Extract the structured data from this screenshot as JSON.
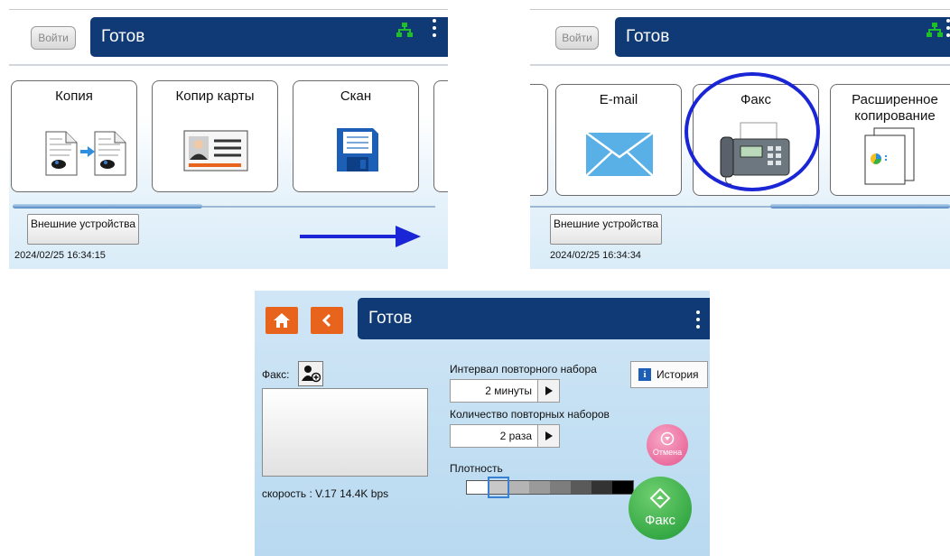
{
  "screen1": {
    "login_label": "Войти",
    "title": "Готов",
    "tiles": [
      {
        "label": "Копия",
        "icon": "copy-icon"
      },
      {
        "label": "Копир карты",
        "icon": "id-card-icon"
      },
      {
        "label": "Скан",
        "icon": "floppy-disk-icon"
      }
    ],
    "external_devices": "Внешние устройства",
    "timestamp": "2024/02/25 16:34:15"
  },
  "screen2": {
    "login_label": "Войти",
    "title": "Готов",
    "tiles": [
      {
        "label": "E-mail",
        "icon": "envelope-icon"
      },
      {
        "label": "Факс",
        "icon": "fax-machine-icon"
      },
      {
        "label": "Расширенное копирование",
        "icon": "advanced-copy-icon"
      }
    ],
    "external_devices": "Внешние устройства",
    "timestamp": "2024/02/25 16:34:34"
  },
  "fax_screen": {
    "title": "Готов",
    "fax_label": "Факс:",
    "speed": "скорость : V.17  14.4K bps",
    "redial_interval_label": "Интервал повторного набора",
    "redial_interval_value": "2 минуты",
    "redial_count_label": "Количество повторных наборов",
    "redial_count_value": "2 раза",
    "density_label": "Плотность",
    "density_selected_index": 1,
    "density_levels": [
      "#ffffff",
      "#c8c8c8",
      "#b4b4b4",
      "#9a9a9a",
      "#7d7d7d",
      "#5a5a5a",
      "#333333",
      "#000000"
    ],
    "history_label": "История",
    "cancel_label": "Отмена",
    "start_label": "Факс"
  },
  "colors": {
    "titlebar": "#0f3a76",
    "orange_button": "#e8641c",
    "annotation_blue": "#1a26d6",
    "network_icon": "#1fbf2a"
  }
}
